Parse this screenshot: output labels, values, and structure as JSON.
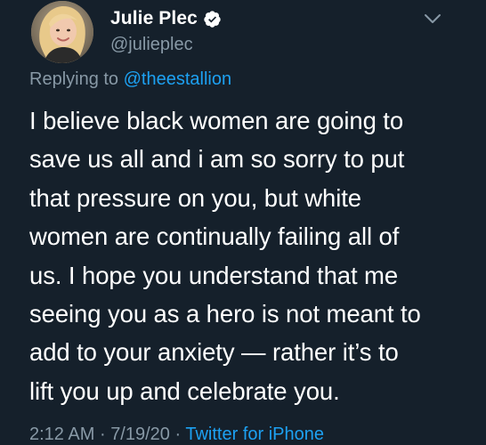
{
  "author": {
    "display_name": "Julie Plec",
    "username": "@julieplec",
    "verified": true
  },
  "reply": {
    "prefix": "Replying to",
    "handle": "@theestallion"
  },
  "tweet": {
    "text": "I believe black women are going to\nsave us all and i am so sorry to put\nthat pressure on you, but white\nwomen are continually failing all of\nus. I hope you understand that me\nseeing you as a hero is not meant to\nadd to your anxiety — rather it’s to\nlift you up and celebrate you."
  },
  "meta": {
    "time": "2:12 AM",
    "separator": "·",
    "date": "7/19/20",
    "source": "Twitter for iPhone"
  },
  "icons": {
    "verified": "verified-badge-icon",
    "menu": "chevron-down-icon"
  },
  "colors": {
    "background": "#15202b",
    "link": "#1da1f2",
    "secondary_text": "#8899a6"
  }
}
